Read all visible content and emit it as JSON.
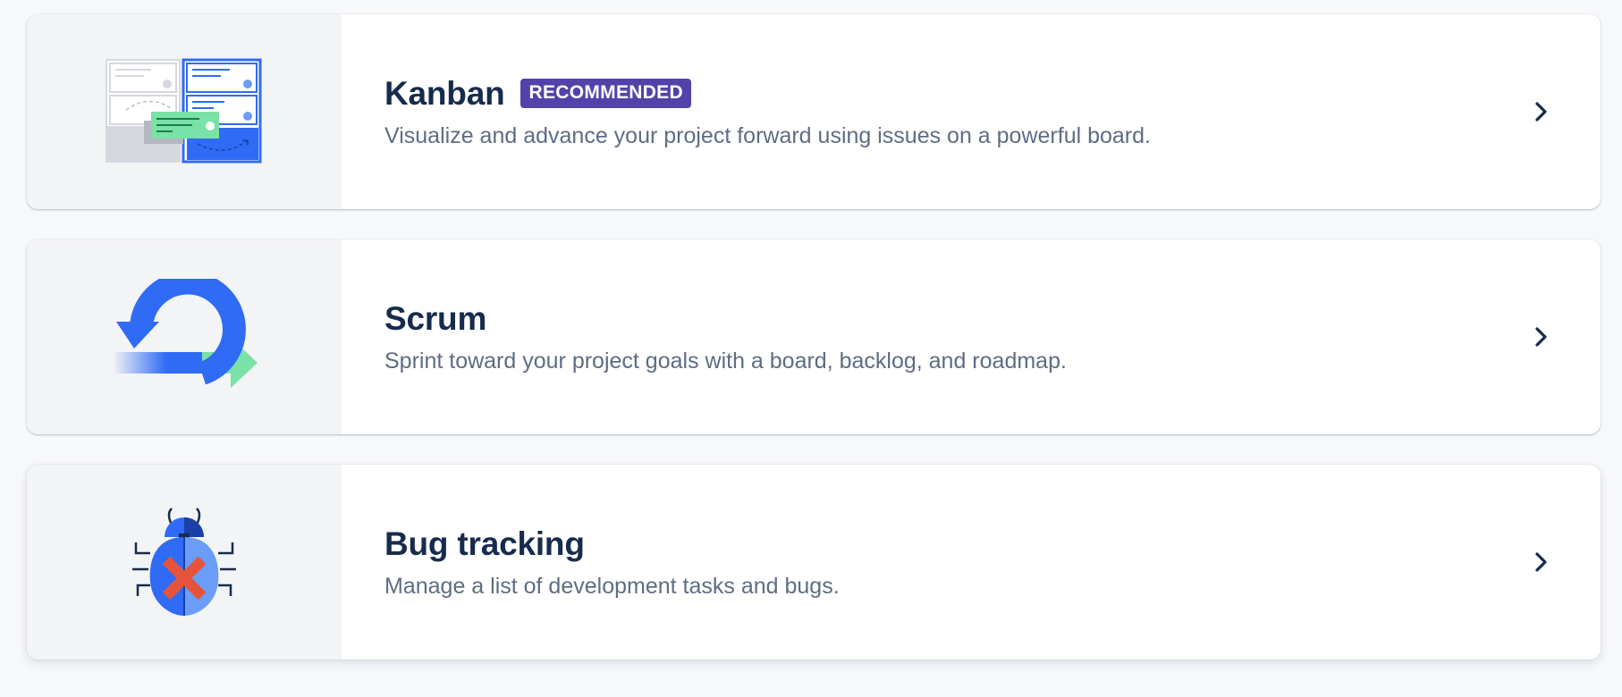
{
  "templates": [
    {
      "title": "Kanban",
      "badge": "RECOMMENDED",
      "description": "Visualize and advance your project forward using issues on a powerful board.",
      "icon": "kanban-board-icon"
    },
    {
      "title": "Scrum",
      "description": "Sprint toward your project goals with a board, backlog, and roadmap.",
      "icon": "scrum-cycle-icon"
    },
    {
      "title": "Bug tracking",
      "description": "Manage a list of development tasks and bugs.",
      "icon": "bug-icon"
    }
  ],
  "colors": {
    "title": "#172b4d",
    "description": "#5e6c84",
    "badge_bg": "#5243aa",
    "accent_blue": "#2f6bf5",
    "accent_green": "#79e2a6",
    "bug_red": "#e5543a"
  }
}
